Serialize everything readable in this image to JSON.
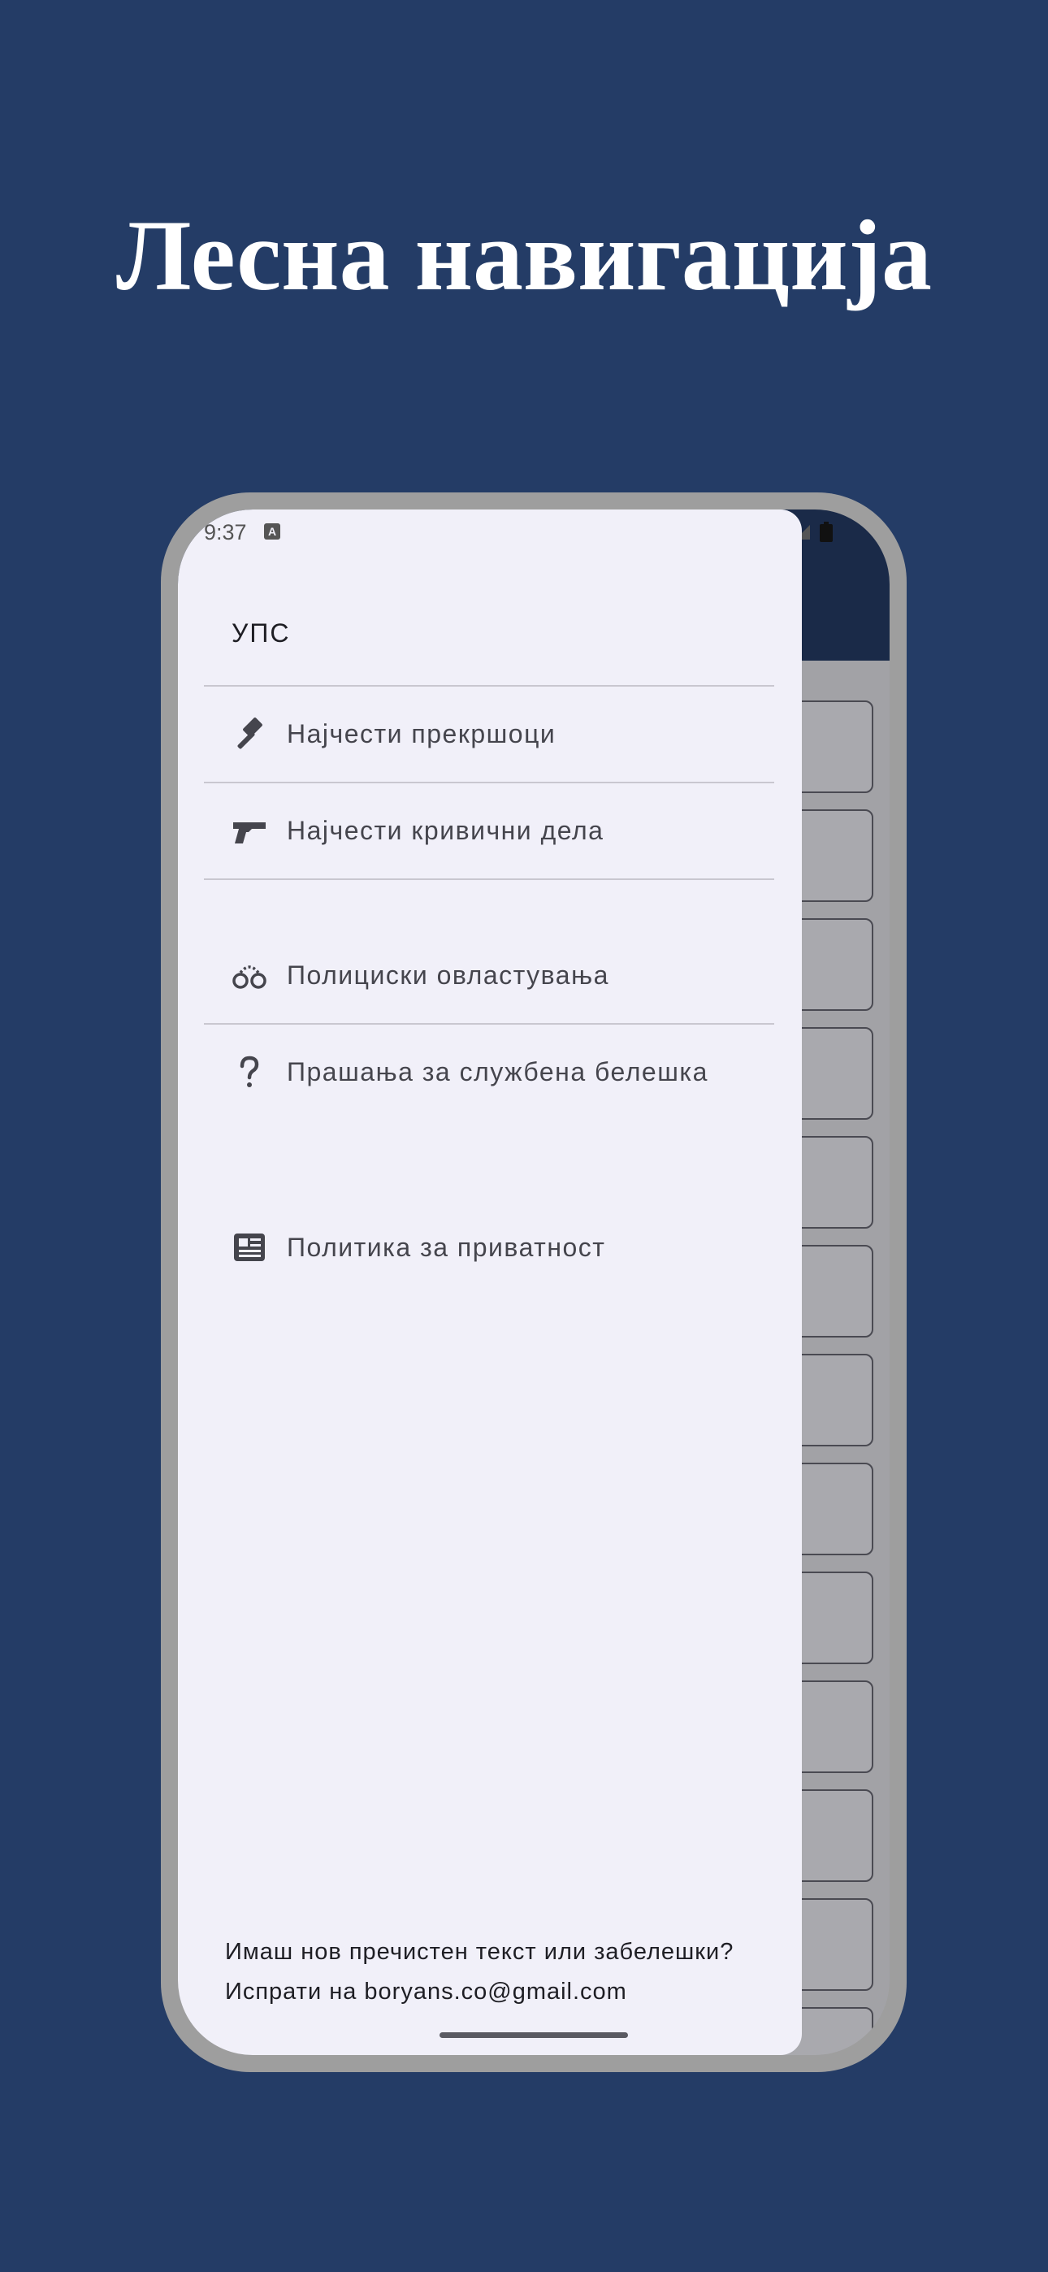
{
  "headline": "Лесна навигација",
  "status_bar": {
    "time": "9:37",
    "notification_badge": "A"
  },
  "drawer": {
    "title": "УПС",
    "items": [
      {
        "icon": "gavel-icon",
        "label": "Најчести прекршоци"
      },
      {
        "icon": "pistol-icon",
        "label": "Најчести кривични дела"
      },
      {
        "icon": "handcuffs-icon",
        "label": "Полициски овластувања"
      },
      {
        "icon": "question-mark-icon",
        "label": "Прашања за службена белешка"
      },
      {
        "icon": "newspaper-icon",
        "label": "Политика за приватност"
      }
    ],
    "footer_line1": "Имаш нов пречистен текст или забелешки?",
    "footer_line2": "Испрати на boryans.co@gmail.com"
  },
  "colors": {
    "background": "#243c66",
    "drawer": "#f1f0f9",
    "app_bar": "#1a2a48",
    "icon": "#45454d"
  }
}
